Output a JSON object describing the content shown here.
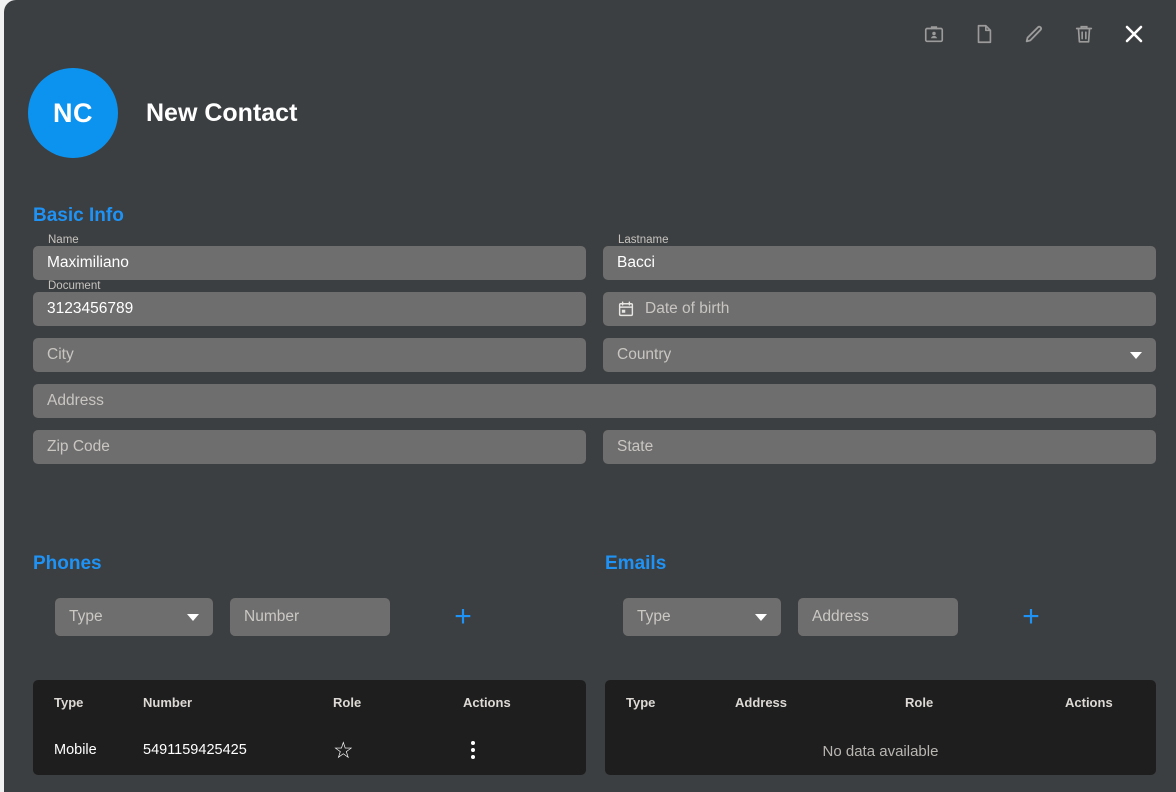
{
  "theme": {
    "accent": "#1e93f5",
    "avatar_bg": "#0c93f0",
    "dialog_bg": "#3c3f41",
    "field_bg": "#6e6e6e",
    "table_bg": "#1e1e1e"
  },
  "toolbar": {
    "icons": [
      {
        "name": "contact-card-icon",
        "label": "Contact card"
      },
      {
        "name": "document-icon",
        "label": "Document"
      },
      {
        "name": "edit-pencil-icon",
        "label": "Edit"
      },
      {
        "name": "delete-trash-icon",
        "label": "Delete"
      },
      {
        "name": "close-icon",
        "label": "Close"
      }
    ]
  },
  "header": {
    "avatar_initials": "NC",
    "title": "New Contact"
  },
  "sections": {
    "basic_info": "Basic Info",
    "phones": "Phones",
    "emails": "Emails"
  },
  "basic_info": {
    "name": {
      "label": "Name",
      "value": "Maximiliano",
      "placeholder": "Name"
    },
    "lastname": {
      "label": "Lastname",
      "value": "Bacci",
      "placeholder": "Lastname"
    },
    "document": {
      "label": "Document",
      "value": "3123456789",
      "placeholder": "Document"
    },
    "date_of_birth": {
      "label": "Date of birth",
      "value": "",
      "placeholder": "Date of birth"
    },
    "city": {
      "label": "City",
      "value": "",
      "placeholder": "City"
    },
    "country": {
      "label": "Country",
      "value": "",
      "placeholder": "Country"
    },
    "address": {
      "label": "Address",
      "value": "",
      "placeholder": "Address"
    },
    "zip_code": {
      "label": "Zip Code",
      "value": "",
      "placeholder": "Zip Code"
    },
    "state": {
      "label": "State",
      "value": "",
      "placeholder": "State"
    }
  },
  "phones": {
    "type_select": {
      "placeholder": "Type",
      "value": ""
    },
    "number_input": {
      "placeholder": "Number",
      "value": ""
    },
    "add_label": "+",
    "columns": [
      "Type",
      "Number",
      "Role",
      "Actions"
    ],
    "rows": [
      {
        "type": "Mobile",
        "number": "5491159425425",
        "role_icon": "star-outline-icon",
        "actions_icon": "more-vertical-icon"
      }
    ]
  },
  "emails": {
    "type_select": {
      "placeholder": "Type",
      "value": ""
    },
    "address_input": {
      "placeholder": "Address",
      "value": ""
    },
    "add_label": "+",
    "columns": [
      "Type",
      "Address",
      "Role",
      "Actions"
    ],
    "rows": [],
    "empty_message": "No data available"
  }
}
